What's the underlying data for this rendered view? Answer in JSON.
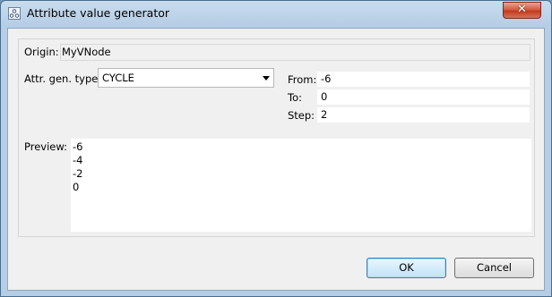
{
  "window": {
    "title": "Attribute value generator",
    "icon": "generator-icon",
    "close_label": "✕"
  },
  "origin": {
    "label": "Origin:",
    "value": "MyVNode"
  },
  "attr_gen": {
    "label": "Attr. gen. type:",
    "selected": "CYCLE"
  },
  "from": {
    "label": "From:",
    "value": "-6"
  },
  "to": {
    "label": "To:",
    "value": "0"
  },
  "step": {
    "label": "Step:",
    "value": "2"
  },
  "preview": {
    "label": "Preview:",
    "values": [
      "-6",
      "-4",
      "-2",
      "0"
    ]
  },
  "buttons": {
    "ok": "OK",
    "cancel": "Cancel"
  }
}
